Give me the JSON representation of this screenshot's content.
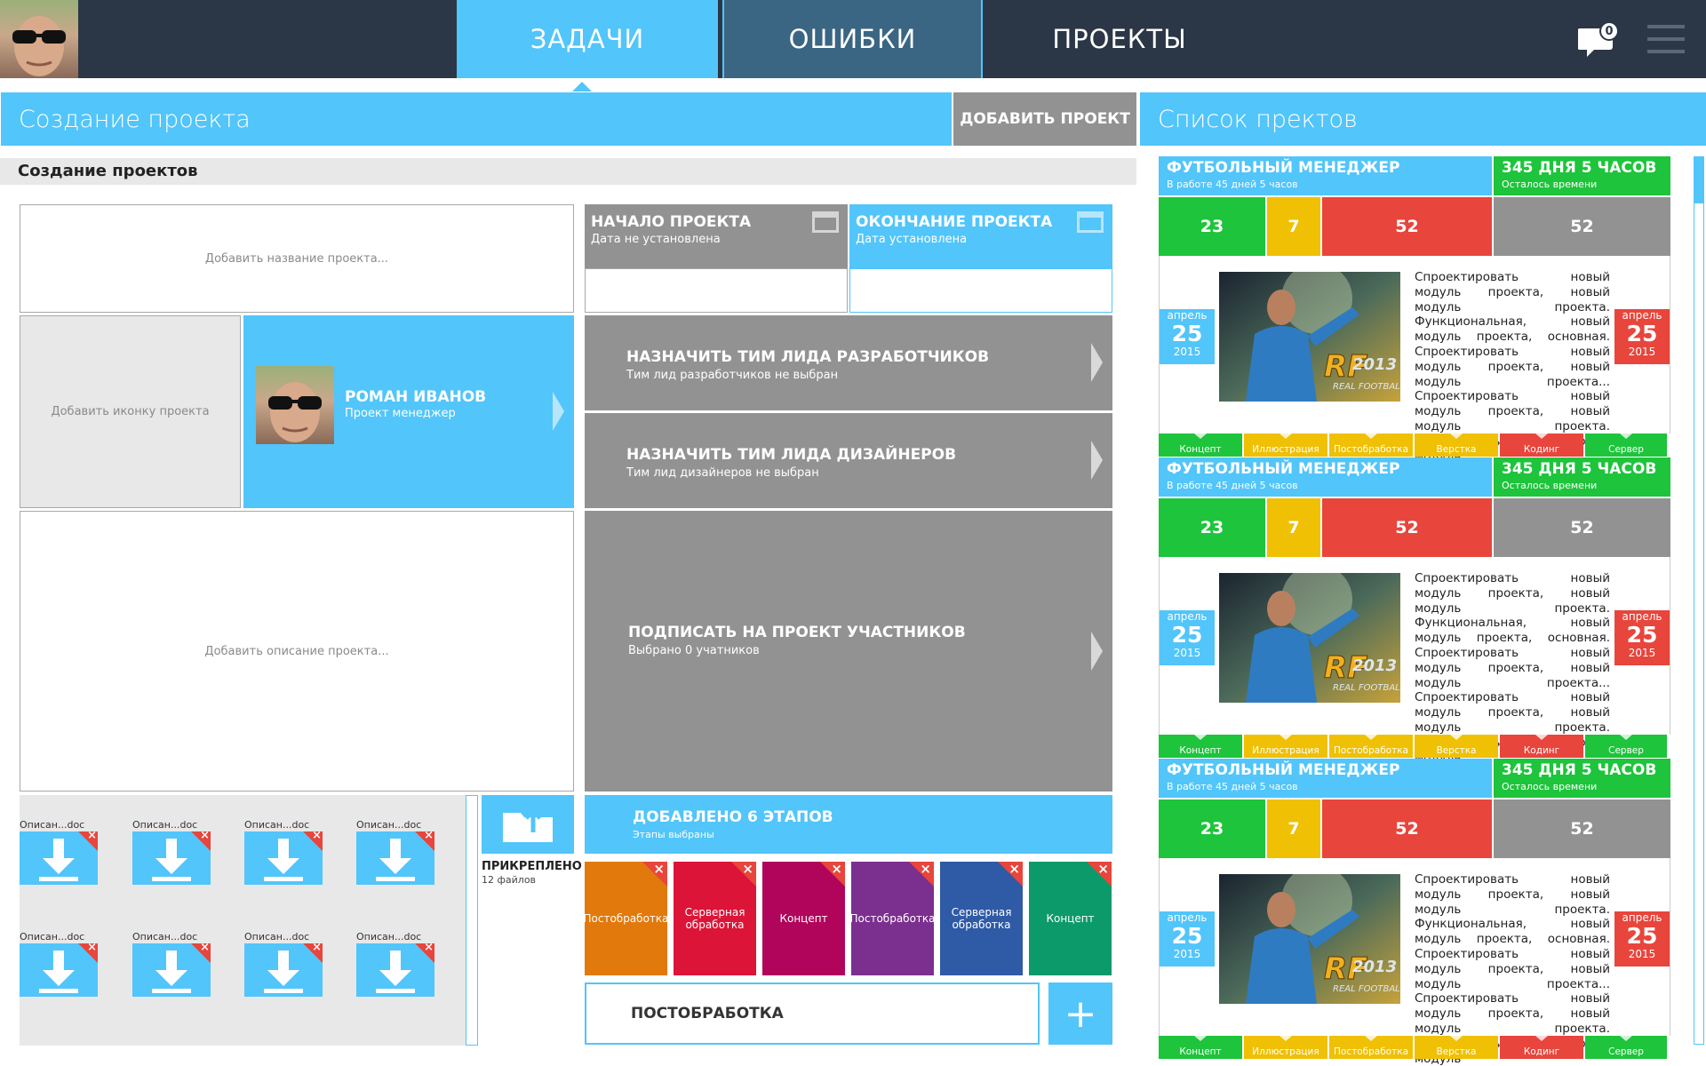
{
  "header": {
    "nav": [
      "ЗАДАЧИ",
      "ОШИБКИ",
      "ПРОЕКТЫ"
    ],
    "notifications_count": "0"
  },
  "create": {
    "title": "Создание проекта",
    "add_button": "ДОБАВИТЬ ПРОЕКТ",
    "section_title": "Создание проектов",
    "name_placeholder": "Добавить название проекта...",
    "icon_placeholder": "Добавить иконку проекта",
    "desc_placeholder": "Добавить описание проекта...",
    "start": {
      "title": "НАЧАЛО ПРОЕКТА",
      "sub": "Дата не установлена"
    },
    "end": {
      "title": "ОКОНЧАНИЕ ПРОЕКТА",
      "sub": "Дата установлена"
    },
    "manager": {
      "name": "РОМАН ИВАНОВ",
      "role": "Проект менеджер"
    },
    "dev_lead": {
      "title": "НАЗНАЧИТЬ ТИМ ЛИДА РАЗРАБОТЧИКОВ",
      "sub": "Тим лид разработчиков не выбран"
    },
    "design_lead": {
      "title": "НАЗНАЧИТЬ ТИМ ЛИДА ДИЗАЙНЕРОВ",
      "sub": "Тим лид дизайнеров не выбран"
    },
    "members": {
      "title": "ПОДПИСАТЬ НА ПРОЕКТ УЧАСТНИКОВ",
      "sub": "Выбрано 0 учатников"
    },
    "files": [
      "Описан...doc",
      "Описан...doc",
      "Описан...doc",
      "Описан...doc",
      "Описан...doc",
      "Описан...doc",
      "Описан...doc",
      "Описан...doc"
    ],
    "attached": {
      "title": "ПРИКРЕПЛЕНО",
      "sub": "12 файлов"
    },
    "stages_header": {
      "title": "ДОБАВЛЕНО 6 ЭТАПОВ",
      "sub": "Этапы выбраны"
    },
    "stages": [
      {
        "label": "Постобработка",
        "color": "#e2790c"
      },
      {
        "label": "Серверная обработка",
        "color": "#dc1438"
      },
      {
        "label": "Концепт",
        "color": "#b0055b"
      },
      {
        "label": "Постобработка",
        "color": "#7b2f8e"
      },
      {
        "label": "Серверная обработка",
        "color": "#2e5aa6"
      },
      {
        "label": "Концепт",
        "color": "#0d9a6a"
      }
    ],
    "stage_input": "ПОСТОБРАБОТКА"
  },
  "list": {
    "title": "Список пректов",
    "cards": [
      {
        "name": "ФУТБОЛЬНЫЙ МЕНЕДЖЕР",
        "work": "В работе 45 дней 5 часов",
        "left": "345 ДНЯ 5 ЧАСОВ",
        "left_sub": "Осталось времени",
        "counts": [
          "23",
          "7",
          "52",
          "52"
        ],
        "start": {
          "month": "апрель",
          "day": "25",
          "year": "2015"
        },
        "end": {
          "month": "апрель",
          "day": "25",
          "year": "2015"
        },
        "desc": "Спроектировать новый модуль проекта, новый модуль проекта. Функциональная, новый модуль проекта, основная. Спроектировать новый модуль проекта, новый модуль проекта... Спроектировать новый модуль проекта, новый модуль проекта. Функциональная, новый модуль",
        "tabs": [
          "Концепт",
          "Иллюстрация",
          "Постобработка",
          "Верстка",
          "Кодинг",
          "Сервер"
        ]
      },
      {
        "name": "ФУТБОЛЬНЫЙ МЕНЕДЖЕР",
        "work": "В работе 45 дней 5 часов",
        "left": "345 ДНЯ 5 ЧАСОВ",
        "left_sub": "Осталось времени",
        "counts": [
          "23",
          "7",
          "52",
          "52"
        ],
        "start": {
          "month": "апрель",
          "day": "25",
          "year": "2015"
        },
        "end": {
          "month": "апрель",
          "day": "25",
          "year": "2015"
        },
        "desc": "Спроектировать новый модуль проекта, новый модуль проекта. Функциональная, новый модуль проекта, основная. Спроектировать новый модуль проекта, новый модуль проекта... Спроектировать новый модуль проекта, новый модуль проекта. Функциональная, новый модуль",
        "tabs": [
          "Концепт",
          "Иллюстрация",
          "Постобработка",
          "Верстка",
          "Кодинг",
          "Сервер"
        ]
      },
      {
        "name": "ФУТБОЛЬНЫЙ МЕНЕДЖЕР",
        "work": "В работе 45 дней 5 часов",
        "left": "345 ДНЯ 5 ЧАСОВ",
        "left_sub": "Осталось времени",
        "counts": [
          "23",
          "7",
          "52",
          "52"
        ],
        "start": {
          "month": "апрель",
          "day": "25",
          "year": "2015"
        },
        "end": {
          "month": "апрель",
          "day": "25",
          "year": "2015"
        },
        "desc": "Спроектировать новый модуль проекта, новый модуль проекта. Функциональная, новый модуль проекта, основная. Спроектировать новый модуль проекта, новый модуль проекта... Спроектировать новый модуль проекта, новый модуль проекта. Функциональная, новый модуль",
        "tabs": [
          "Концепт",
          "Иллюстрация",
          "Постобработка",
          "Верстка",
          "Кодинг",
          "Сервер"
        ]
      }
    ]
  },
  "colors": {
    "accent": "#52c5fa",
    "dark": "#2b3746",
    "green": "#1ec43b",
    "red": "#e8453c",
    "yellow": "#efc004",
    "grey": "#929292"
  }
}
